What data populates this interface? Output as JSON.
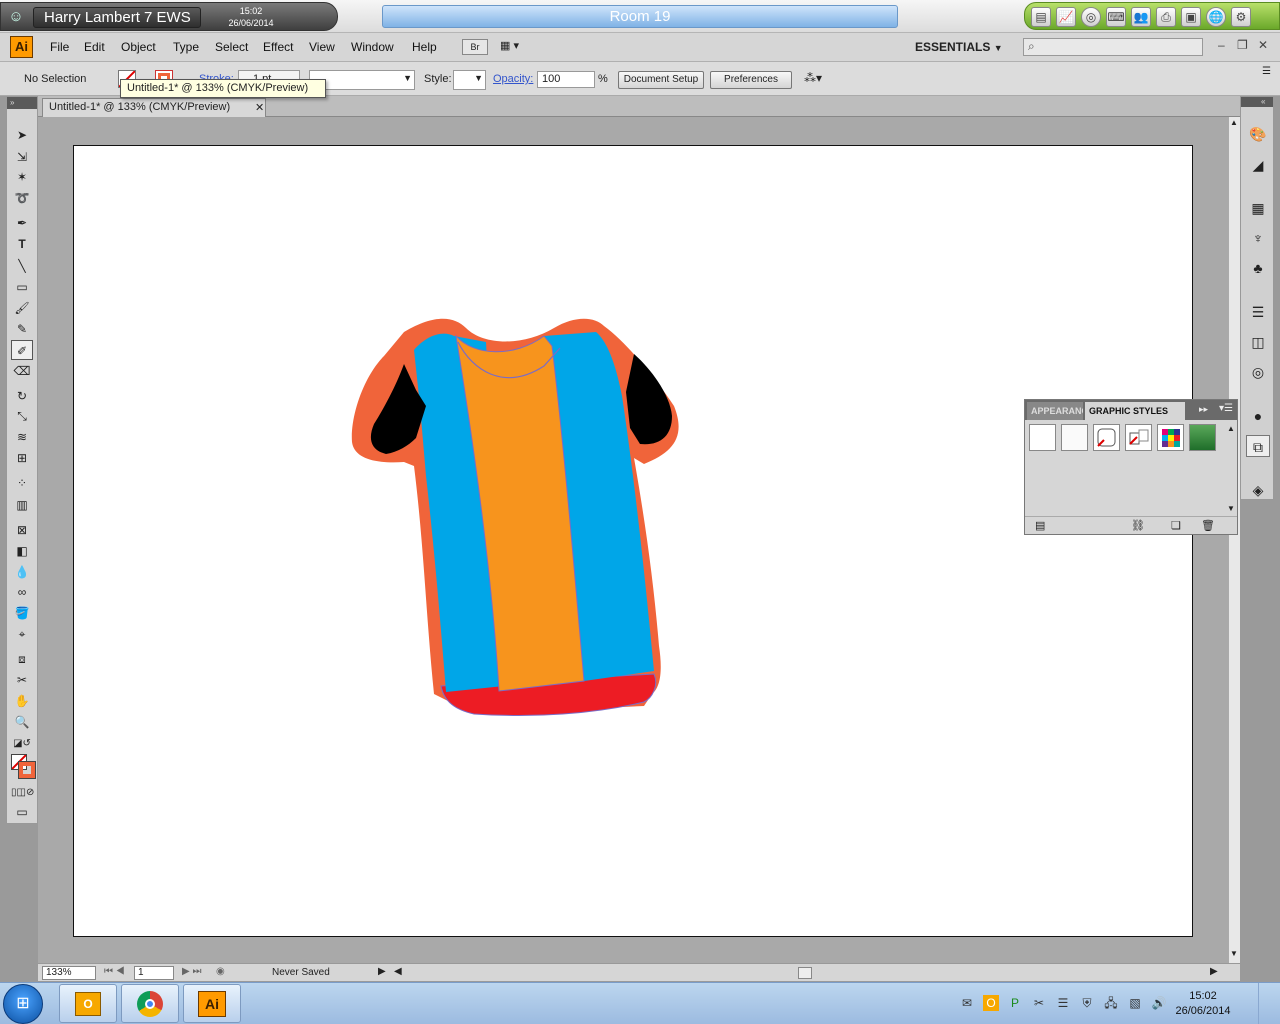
{
  "system": {
    "username": "Harry Lambert 7 EWS",
    "time": "15:02",
    "date": "26/06/2014",
    "room": "Room 19"
  },
  "menu": {
    "app_logo": "Ai",
    "items": [
      "File",
      "Edit",
      "Object",
      "Type",
      "Select",
      "Effect",
      "View",
      "Window",
      "Help"
    ],
    "bridge": "Br",
    "workspace": "ESSENTIALS",
    "search_placeholder": ""
  },
  "control_bar": {
    "selection": "No Selection",
    "stroke_label": "Stroke:",
    "stroke_value": "1 pt",
    "style_label": "Style:",
    "opacity_label": "Opacity:",
    "opacity_value": "100",
    "percent": "%",
    "document_setup": "Document Setup",
    "preferences": "Preferences"
  },
  "tooltip": "Untitled-1* @ 133% (CMYK/Preview)",
  "document_tab": {
    "title": "Untitled-1* @ 133% (CMYK/Preview)",
    "close": "✕"
  },
  "status_bar": {
    "zoom": "133%",
    "page": "1",
    "save_status": "Never Saved"
  },
  "graphic_styles_panel": {
    "tab_appearance": "APPEARANCE",
    "tab_graphic_styles": "GRAPHIC STYLES"
  },
  "taskbar": {
    "apps": [
      "outlook",
      "chrome",
      "illustrator"
    ],
    "illustrator_label": "Ai",
    "time": "15:02",
    "date": "26/06/2014"
  },
  "colors": {
    "shirt_outline": "#f0643a",
    "shirt_blue": "#00a6e8",
    "shirt_orange": "#f7941d",
    "shirt_hem": "#ed1c24",
    "sleeve_black": "#000000",
    "illustrator_orange": "#ff9a00",
    "titlebar_blue": "#7fb2e6"
  }
}
